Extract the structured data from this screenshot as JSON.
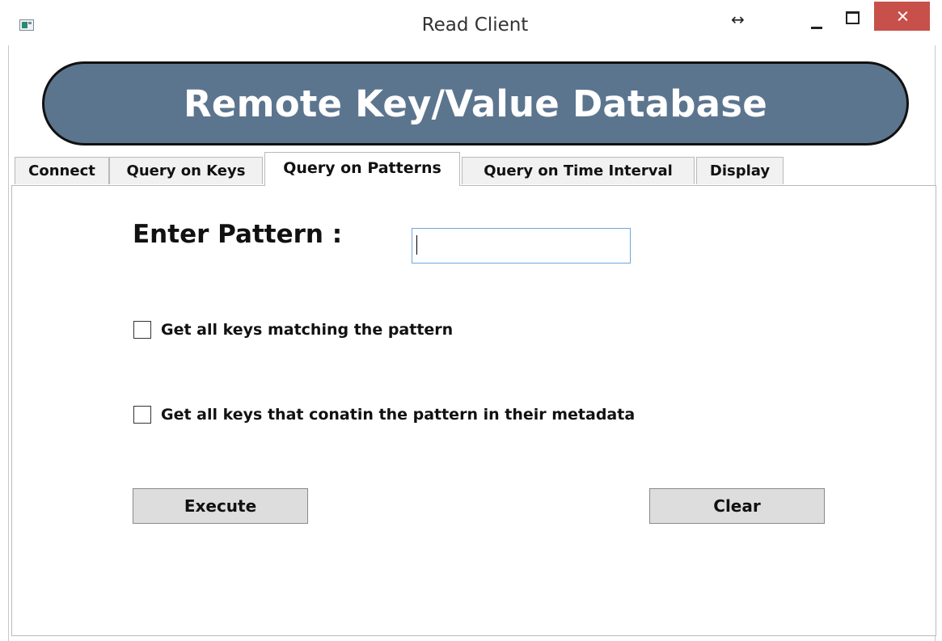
{
  "window": {
    "title": "Read Client",
    "resize_glyph": "↔",
    "controls": [
      "minimize-icon",
      "maximize-icon",
      "close-icon"
    ],
    "close_color": "#c7504a"
  },
  "banner": {
    "text": "Remote Key/Value Database",
    "color": "#5c758f"
  },
  "tabs": [
    {
      "label": "Connect",
      "active": false
    },
    {
      "label": "Query on Keys",
      "active": false
    },
    {
      "label": "Query on Patterns",
      "active": true
    },
    {
      "label": "Query on Time Interval",
      "active": false
    },
    {
      "label": "Display",
      "active": false
    }
  ],
  "form": {
    "pattern_label": "Enter Pattern :",
    "pattern_value": "",
    "options": [
      {
        "label": "Get all keys matching the pattern",
        "checked": false
      },
      {
        "label": "Get all keys that conatin the pattern in their metadata",
        "checked": false
      }
    ],
    "execute_label": "Execute",
    "clear_label": "Clear"
  }
}
